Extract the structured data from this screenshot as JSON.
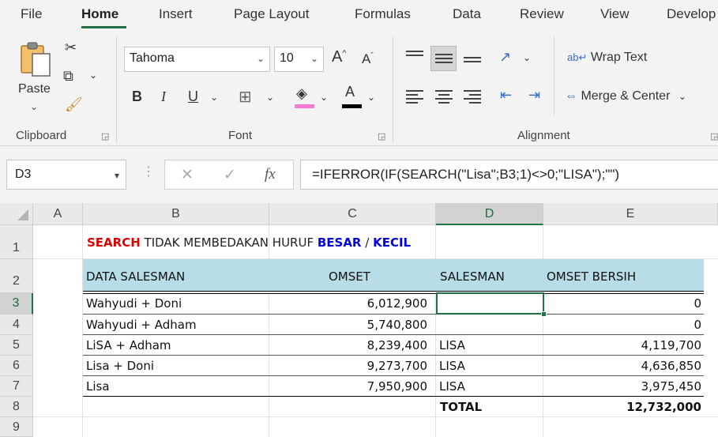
{
  "menu": {
    "tabs": [
      "File",
      "Home",
      "Insert",
      "Page Layout",
      "Formulas",
      "Data",
      "Review",
      "View",
      "Develop"
    ],
    "active": "Home"
  },
  "ribbon": {
    "clipboard": {
      "paste_label": "Paste",
      "group_label": "Clipboard"
    },
    "font": {
      "font_name": "Tahoma",
      "font_size": "10",
      "bold": "B",
      "italic": "I",
      "underline": "U",
      "font_color_glyph": "A",
      "group_label": "Font"
    },
    "alignment": {
      "wrap_text": "Wrap Text",
      "merge_center": "Merge & Center",
      "group_label": "Alignment"
    }
  },
  "formula_bar": {
    "name_box": "D3",
    "formula": "=IFERROR(IF(SEARCH(\"Lisa\";B3;1)<>0;\"LISA\");\"\")"
  },
  "sheet": {
    "columns": [
      "A",
      "B",
      "C",
      "D",
      "E"
    ],
    "selected_column": "D",
    "rows": [
      "1",
      "2",
      "3",
      "4",
      "5",
      "6",
      "7",
      "8",
      "9"
    ],
    "selected_row": "3",
    "title": {
      "search": "SEARCH",
      "middle": " TIDAK MEMBEDAKAN HURUF ",
      "besar": "BESAR",
      "slash": " / ",
      "kecil": "KECIL"
    },
    "headers": {
      "data_salesman": "DATA SALESMAN",
      "omset": "OMSET",
      "salesman": "SALESMAN",
      "omset_bersih": "OMSET BERSIH"
    },
    "data": [
      {
        "name": "Wahyudi + Doni",
        "omset": "6,012,900",
        "salesman": "",
        "bersih": "0"
      },
      {
        "name": "Wahyudi + Adham",
        "omset": "5,740,800",
        "salesman": "",
        "bersih": "0"
      },
      {
        "name": "LiSA + Adham",
        "omset": "8,239,400",
        "salesman": "LISA",
        "bersih": "4,119,700"
      },
      {
        "name": "Lisa + Doni",
        "omset": "9,273,700",
        "salesman": "LISA",
        "bersih": "4,636,850"
      },
      {
        "name": "Lisa",
        "omset": "7,950,900",
        "salesman": "LISA",
        "bersih": "3,975,450"
      }
    ],
    "total_label": "TOTAL",
    "total_value": "12,732,000"
  }
}
